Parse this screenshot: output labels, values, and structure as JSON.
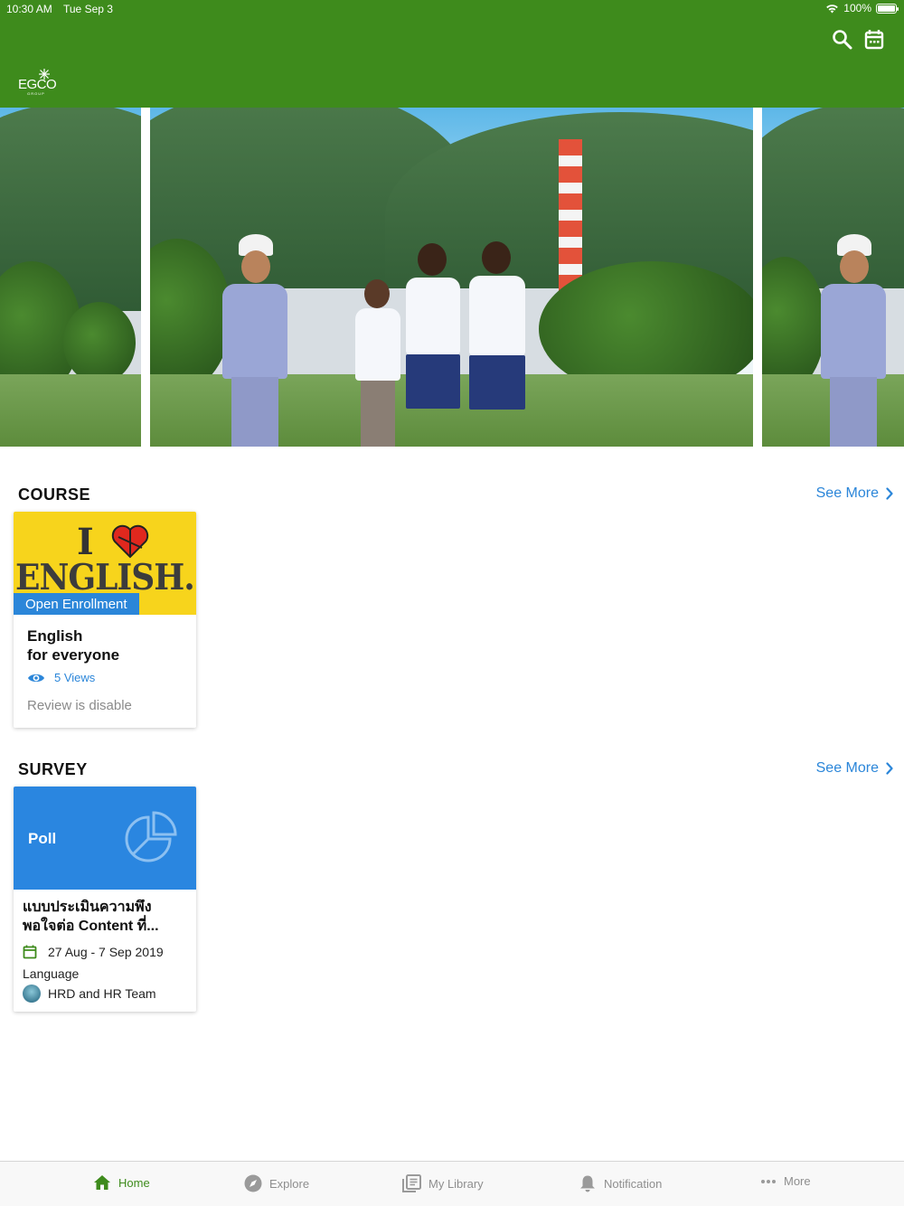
{
  "status_bar": {
    "time": "10:30 AM",
    "date": "Tue Sep 3",
    "battery": "100%",
    "battery_level": 1.0
  },
  "header": {
    "logo_text": "EGCO",
    "logo_subtext": "GROUP",
    "icons": [
      "search-icon",
      "calendar-icon"
    ],
    "background_color": "#3e8b1c"
  },
  "course_section": {
    "title": "COURSE",
    "see_more": "See More",
    "card": {
      "thumbnail_text_top": "I",
      "thumbnail_text_main": "ENGLISH.",
      "badge": "Open Enrollment",
      "title_line1": "English",
      "title_line2": "for everyone",
      "views": "5 Views",
      "review": "Review is disable"
    }
  },
  "survey_section": {
    "title": "SURVEY",
    "see_more": "See More",
    "card": {
      "type_label": "Poll",
      "title": "แบบประเมินความพึง\nพอใจต่อ Content ที่...",
      "date_range": "27 Aug - 7 Sep 2019",
      "category": "Language",
      "owner": "HRD and HR Team"
    }
  },
  "tab_bar": {
    "tabs": [
      {
        "label": "Home",
        "icon": "home-icon",
        "active": true
      },
      {
        "label": "Explore",
        "icon": "compass-icon",
        "active": false
      },
      {
        "label": "My Library",
        "icon": "library-icon",
        "active": false
      },
      {
        "label": "Notification",
        "icon": "bell-icon",
        "active": false
      },
      {
        "label": "More",
        "icon": "more-icon",
        "active": false
      }
    ]
  },
  "colors": {
    "brand_green": "#3e8b1c",
    "link_blue": "#2b86d9",
    "poll_blue": "#2a86e0"
  }
}
